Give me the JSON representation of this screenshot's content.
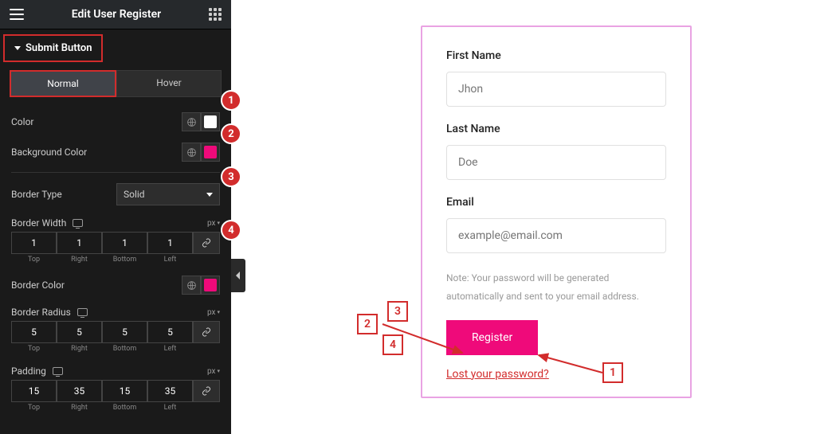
{
  "header": {
    "title": "Edit User Register"
  },
  "section": {
    "title": "Submit Button"
  },
  "tabs": {
    "normal": "Normal",
    "hover": "Hover"
  },
  "controls": {
    "color": {
      "label": "Color",
      "value": "#ffffff"
    },
    "bg": {
      "label": "Background Color",
      "value": "#ef0a7a"
    },
    "borderType": {
      "label": "Border Type",
      "selected": "Solid"
    },
    "borderWidth": {
      "label": "Border Width",
      "unit": "px",
      "top": "1",
      "right": "1",
      "bottom": "1",
      "left": "1"
    },
    "borderColor": {
      "label": "Border Color",
      "value": "#ef0a7a"
    },
    "borderRadius": {
      "label": "Border Radius",
      "unit": "px",
      "top": "5",
      "right": "5",
      "bottom": "5",
      "left": "5"
    },
    "padding": {
      "label": "Padding",
      "unit": "px",
      "top": "15",
      "right": "35",
      "bottom": "15",
      "left": "35"
    }
  },
  "dimLabels": {
    "top": "Top",
    "right": "Right",
    "bottom": "Bottom",
    "left": "Left"
  },
  "annot": {
    "a1": "1",
    "a2": "2",
    "a3": "3",
    "a4": "4"
  },
  "preview": {
    "first": {
      "label": "First Name",
      "placeholder": "Jhon"
    },
    "last": {
      "label": "Last Name",
      "placeholder": "Doe"
    },
    "email": {
      "label": "Email",
      "placeholder": "example@email.com"
    },
    "note": "Note: Your password will be generated automatically and sent to your email address.",
    "button": "Register",
    "lost": "Lost your password?"
  },
  "sq": {
    "s1": "1",
    "s2": "2",
    "s3": "3",
    "s4": "4"
  }
}
